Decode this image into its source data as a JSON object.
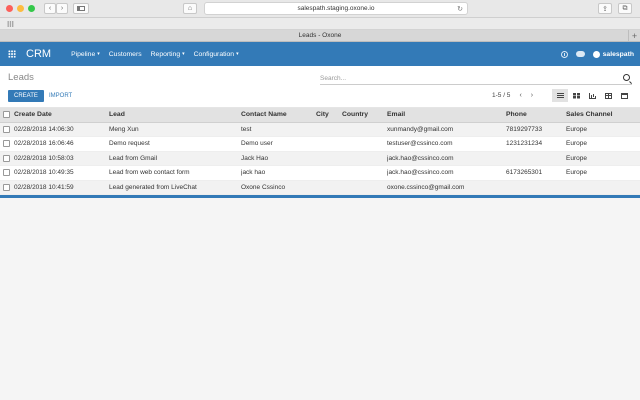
{
  "browser": {
    "url": "salespath.staging.oxone.io",
    "tab_title": "Leads - Oxone"
  },
  "topnav": {
    "brand": "CRM",
    "menus": [
      {
        "label": "Pipeline",
        "has_caret": true
      },
      {
        "label": "Customers",
        "has_caret": false
      },
      {
        "label": "Reporting",
        "has_caret": true
      },
      {
        "label": "Configuration",
        "has_caret": true
      }
    ],
    "caret": "▾",
    "user": "salespath"
  },
  "control": {
    "title": "Leads",
    "search_placeholder": "Search...",
    "create_label": "CREATE",
    "import_label": "IMPORT",
    "pager": "1-5 / 5",
    "prev": "‹",
    "next": "›",
    "views": [
      "list-view",
      "kanban-view",
      "graph-view",
      "pivot-view",
      "calendar-view"
    ],
    "active_view": "list-view"
  },
  "table": {
    "headers": [
      "Create Date",
      "Lead",
      "Contact Name",
      "City",
      "Country",
      "Email",
      "Phone",
      "Sales Channel"
    ],
    "rows": [
      {
        "create_date": "02/28/2018 14:06:30",
        "lead": "Meng Xun",
        "contact": "test",
        "city": "",
        "country": "",
        "email": "xunmandy@gmail.com",
        "phone": "7819297733",
        "channel": "Europe"
      },
      {
        "create_date": "02/28/2018 16:06:46",
        "lead": "Demo request",
        "contact": "Demo user",
        "city": "",
        "country": "",
        "email": "testuser@cssinco.com",
        "phone": "1231231234",
        "channel": "Europe"
      },
      {
        "create_date": "02/28/2018 10:58:03",
        "lead": "Lead from Gmail",
        "contact": "Jack Hao",
        "city": "",
        "country": "",
        "email": "jack.hao@cssinco.com",
        "phone": "",
        "channel": "Europe"
      },
      {
        "create_date": "02/28/2018 10:49:35",
        "lead": "Lead from web contact form",
        "contact": "jack hao",
        "city": "",
        "country": "",
        "email": "jack.hao@cssinco.com",
        "phone": "6173265301",
        "channel": "Europe"
      },
      {
        "create_date": "02/28/2018 10:41:59",
        "lead": "Lead generated from LiveChat",
        "contact": "Oxone Cssinco",
        "city": "",
        "country": "",
        "email": "oxone.cssinco@gmail.com",
        "phone": "",
        "channel": ""
      }
    ]
  },
  "colors": {
    "brand_blue": "#337ab7",
    "header_gray": "#e2e2e2",
    "odd_row": "#f2f2f2"
  }
}
